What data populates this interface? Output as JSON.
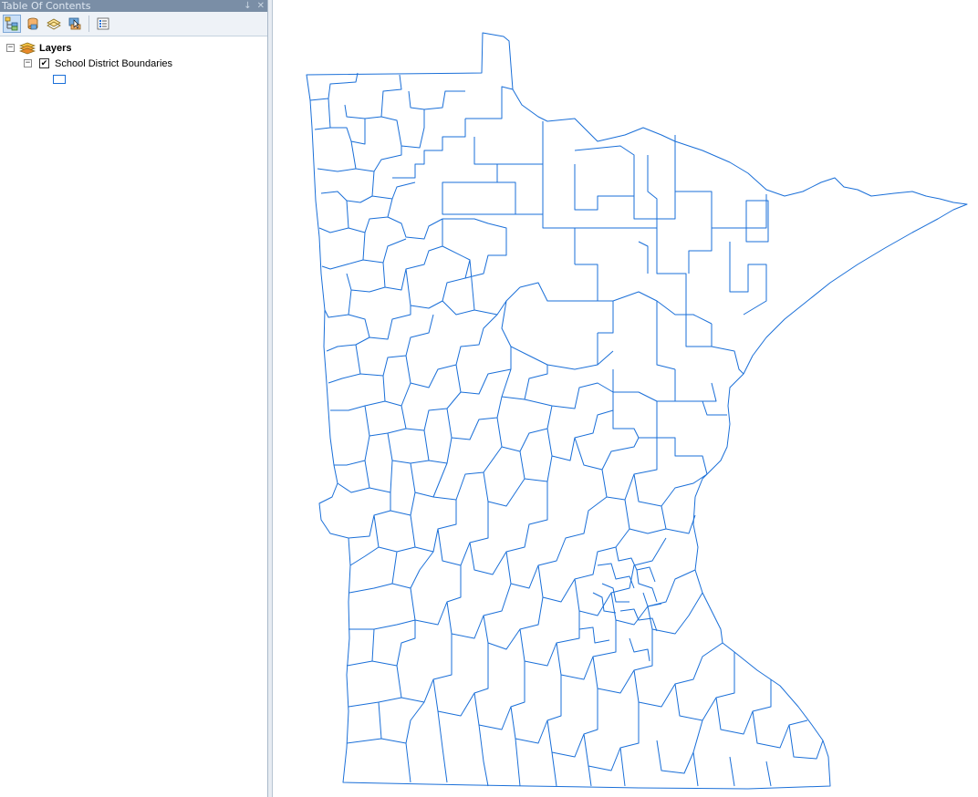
{
  "toc": {
    "title": "Table Of Contents",
    "pin_glyph": "↓",
    "close_glyph": "✕",
    "toolbar": [
      {
        "name": "list-by-drawing-order-icon",
        "active": true
      },
      {
        "name": "list-by-source-icon",
        "active": false
      },
      {
        "name": "list-by-visibility-icon",
        "active": false
      },
      {
        "name": "list-by-selection-icon",
        "active": false
      },
      {
        "name": "options-icon",
        "active": false
      }
    ],
    "root": {
      "label": "Layers",
      "expander": "−"
    },
    "layer": {
      "label": "School District Boundaries",
      "expander": "−",
      "checked": true,
      "check_glyph": "✔"
    },
    "symbol": {
      "stroke_color": "#1a6fd8",
      "fill_color": "#ffffff"
    }
  },
  "map": {
    "layer_name": "School District Boundaries",
    "stroke_color": "#1a6fd8",
    "background": "#ffffff"
  }
}
